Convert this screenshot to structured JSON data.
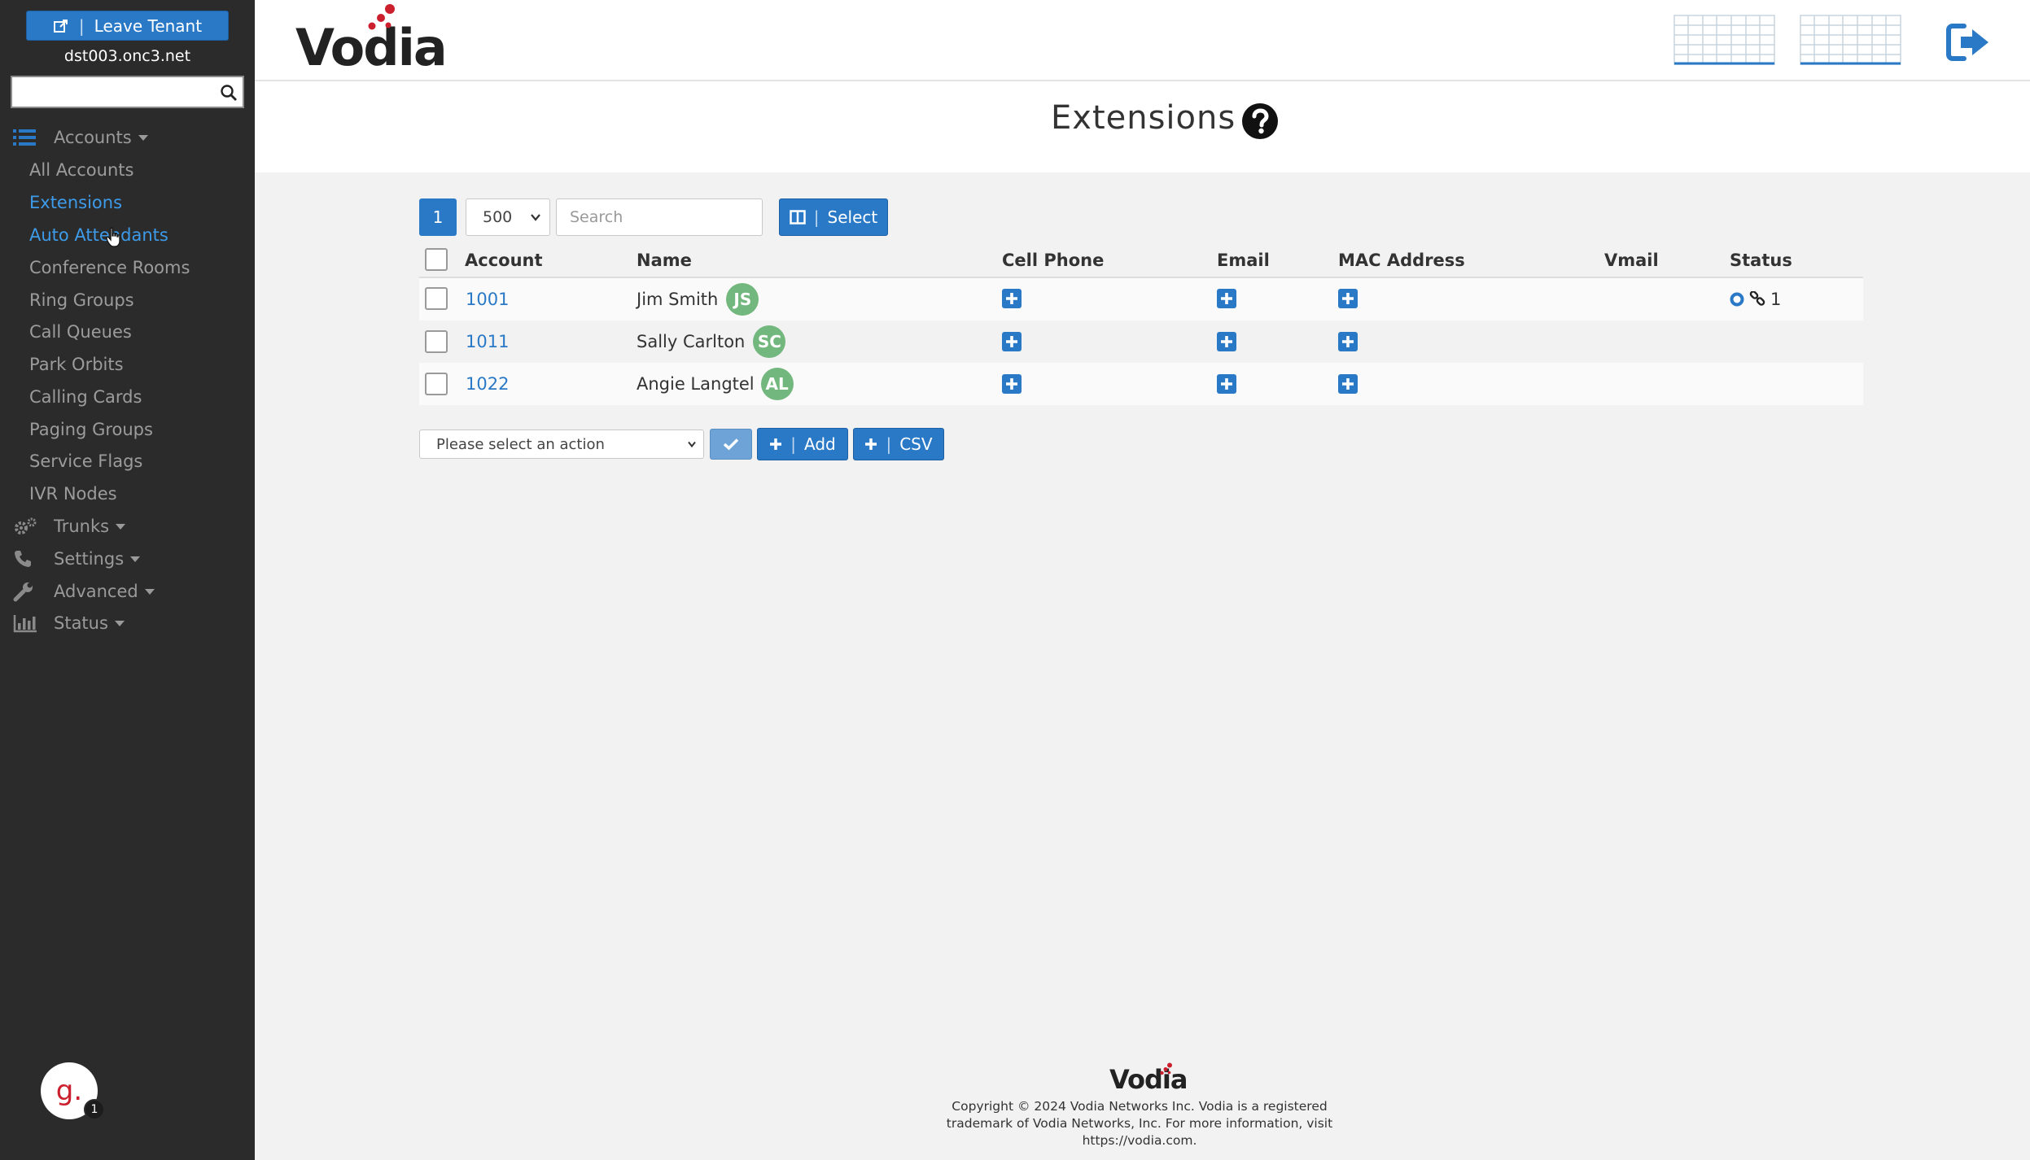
{
  "sidebar": {
    "leave_tenant_label": "Leave Tenant",
    "tenant_domain": "dst003.onc3.net",
    "search_value": "",
    "categories": {
      "accounts": "Accounts",
      "trunks": "Trunks",
      "settings": "Settings",
      "advanced": "Advanced",
      "status": "Status"
    },
    "account_items": [
      "All Accounts",
      "Extensions",
      "Auto Attendants",
      "Conference Rooms",
      "Ring Groups",
      "Call Queues",
      "Park Orbits",
      "Calling Cards",
      "Paging Groups",
      "Service Flags",
      "IVR Nodes"
    ],
    "active_item": "Extensions",
    "gravatar_letter": "g.",
    "gravatar_badge": "1"
  },
  "header": {
    "logo_text": "Vodia"
  },
  "page": {
    "title": "Extensions"
  },
  "toolbar": {
    "page_number": "1",
    "page_size": "500",
    "search_placeholder": "Search",
    "select_label": "Select"
  },
  "table": {
    "columns": {
      "account": "Account",
      "name": "Name",
      "cell_phone": "Cell Phone",
      "email": "Email",
      "mac": "MAC Address",
      "vmail": "Vmail",
      "status": "Status"
    },
    "rows": [
      {
        "account": "1001",
        "name": "Jim Smith",
        "initials": "JS",
        "status_count": "1"
      },
      {
        "account": "1011",
        "name": "Sally Carlton",
        "initials": "SC",
        "status_count": ""
      },
      {
        "account": "1022",
        "name": "Angie Langtel",
        "initials": "AL",
        "status_count": ""
      }
    ]
  },
  "actions": {
    "select_placeholder": "Please select an action",
    "add_label": "Add",
    "csv_label": "CSV"
  },
  "footer": {
    "logo_text": "Vodia",
    "line1": "Copyright © 2024 Vodia Networks Inc. Vodia is a registered",
    "line2": "trademark of Vodia Networks, Inc. For more information, visit",
    "line3": "https://vodia.com."
  },
  "colors": {
    "sidebar_bg": "#2b2b2b",
    "primary": "#2a79c7",
    "active_link": "#3d9be9",
    "avatar_green": "#72b77d",
    "brand_red": "#cc1f2d"
  }
}
